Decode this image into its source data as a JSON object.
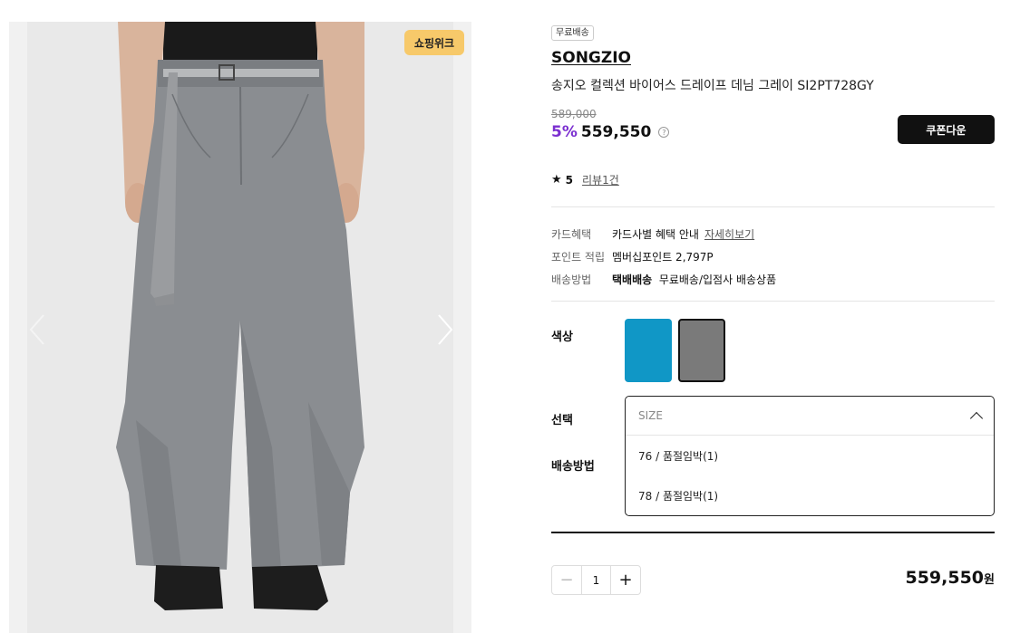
{
  "gallery": {
    "badge": "쇼핑위크",
    "prev_icon": "chevron-left-icon",
    "next_icon": "chevron-right-icon"
  },
  "product": {
    "shipping_tag": "무료배송",
    "brand": "SONGZIO",
    "name": "송지오 컬렉션 바이어스 드레이프 데님 그레이 SI2PT728GY",
    "original_price": "589,000",
    "discount": "5%",
    "sale_price": "559,550",
    "coupon_button": "쿠폰다운",
    "rating": "5",
    "review_link": "리뷰1건"
  },
  "benefits": [
    {
      "label": "카드혜택",
      "value": "카드사별 혜택 안내",
      "link": "자세히보기"
    },
    {
      "label": "포인트 적립",
      "value": "멤버십포인트 2,797P"
    },
    {
      "label": "배송방법",
      "value_bold": "택배배송",
      "value": "무료배송/입점사 배송상품"
    }
  ],
  "options": {
    "color_label": "색상",
    "select_label": "선택",
    "shipping_label": "배송방법",
    "colors": [
      "#1097c6",
      "#7a7a7a"
    ],
    "select_placeholder": "SIZE",
    "size_options": [
      "76 / 품절임박(1)",
      "78 / 품절임박(1)"
    ]
  },
  "quantity": {
    "minus": "−",
    "value": "1",
    "plus": "+"
  },
  "total": {
    "amount": "559,550",
    "unit": "원"
  }
}
